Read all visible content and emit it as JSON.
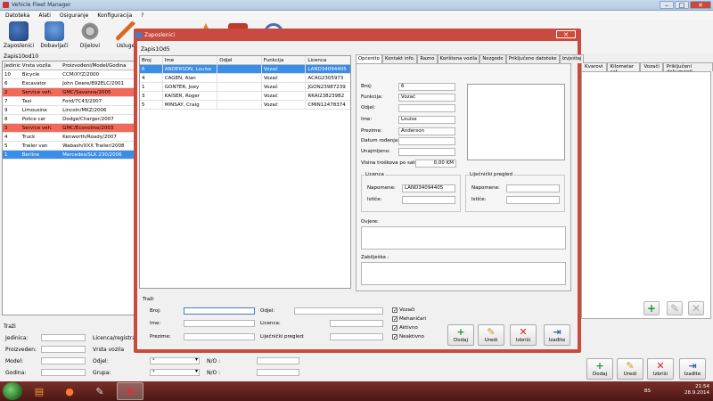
{
  "main": {
    "title": "Vehicle Fleet Manager",
    "menu": [
      "Datoteka",
      "Alati",
      "Osiguranje",
      "Konfiguracija",
      "?"
    ],
    "toolbar": [
      {
        "label": "Zaposlenici",
        "icon": "employees-icon"
      },
      {
        "label": "Dobavljači",
        "icon": "suppliers-icon"
      },
      {
        "label": "Dijelovi",
        "icon": "parts-gear-icon"
      },
      {
        "label": "Usluge",
        "icon": "services-tools-icon"
      }
    ],
    "record_count": "Zapis10od10",
    "vehicle_table": {
      "headers": [
        "Jedinic",
        "Vrsta vozila",
        "Proizvođeni/Model/Godina"
      ],
      "rows": [
        {
          "id": "10",
          "type": "Bicycle",
          "model": "CCM/XYZ/2000",
          "style": ""
        },
        {
          "id": "6",
          "type": "Excavator",
          "model": "John Deere/892ELC/2001",
          "style": ""
        },
        {
          "id": "2",
          "type": "Service veh.",
          "model": "GMC/Savanna/2005",
          "style": "red"
        },
        {
          "id": "7",
          "type": "Taxi",
          "model": "Ford/7C43/2007",
          "style": ""
        },
        {
          "id": "9",
          "type": "Limousine",
          "model": "Lincoln/MKZ/2006",
          "style": ""
        },
        {
          "id": "8",
          "type": "Police car",
          "model": "Dodge/Charger/2007",
          "style": ""
        },
        {
          "id": "3",
          "type": "Service veh.",
          "model": "GMC/Econoline/2003",
          "style": "red"
        },
        {
          "id": "4",
          "type": "Truck",
          "model": "Kenworth/Roady/2007",
          "style": ""
        },
        {
          "id": "5",
          "type": "Trailer van",
          "model": "Wabash/XXX Trailer/2008",
          "style": ""
        },
        {
          "id": "1",
          "type": "Berline",
          "model": "Mercedes/SLK 230/2006",
          "style": "blue"
        }
      ]
    },
    "right_tabs": [
      "Kvarovi",
      "Kilometar sat",
      "Vozači",
      "Priključeni dokumenti"
    ],
    "search": {
      "title": "Traži",
      "labels": {
        "jedinica": "Jedinica:",
        "proizveden": "Proizveden:",
        "model": "Model:",
        "godina": "Godina:",
        "licenca": "Licenca/registracija",
        "vrsta": "Vrsta vozila",
        "odjel": "Odjel:",
        "grupa": "Grupa:",
        "no1": "N/O :",
        "no2": "N/O :"
      },
      "odjel_value": "*",
      "grupa_value": "*"
    },
    "buttons": {
      "add": "Dodaj",
      "edit": "Uredi",
      "delete": "Izbriši",
      "exit": "Izađite"
    }
  },
  "dialog": {
    "title": "Zaposlenici",
    "record_count": "Zapis1Od5",
    "table": {
      "headers": [
        "Broj",
        "Ime",
        "Odjel",
        "Funkcija",
        "Licenca"
      ],
      "rows": [
        {
          "num": "6",
          "name": "ANDERSON, Louise",
          "dept": "",
          "func": "Vozač",
          "lic": "LAND34094405",
          "selected": true
        },
        {
          "num": "4",
          "name": "CAGEN, Alan",
          "dept": "",
          "func": "Vozač",
          "lic": "ACAG2305973",
          "selected": false
        },
        {
          "num": "1",
          "name": "GONTER, Joey",
          "dept": "",
          "func": "Vozač",
          "lic": "JGON23987239",
          "selected": false
        },
        {
          "num": "3",
          "name": "KAISER, Roger",
          "dept": "",
          "func": "Vozač",
          "lic": "RKAI23823982",
          "selected": false
        },
        {
          "num": "5",
          "name": "MINSAY, Craig",
          "dept": "",
          "func": "Vozač",
          "lic": "CMIN12478374",
          "selected": false
        }
      ]
    },
    "tabs": [
      "Općenito",
      "Kontakt info.",
      "Razno",
      "Korištena vozila",
      "Nezgode",
      "Priključene datoteke",
      "Izvještaj"
    ],
    "form": {
      "broj_label": "Broj:",
      "broj": "6",
      "funkcija_label": "Funkcija:",
      "funkcija": "Vozač",
      "odjel_label": "Odjel:",
      "odjel": "",
      "ime_label": "Ime:",
      "ime": "Louise",
      "prezime_label": "Prezime:",
      "prezime": "Anderson",
      "datum_label": "Datum rođenja:",
      "datum": "",
      "unajmljeno_label": "Unajmljeno:",
      "unajmljeno": "",
      "visina_label": "Visina troškova po satu:",
      "visina": "0,00 KM",
      "licenca_group": "Licenca",
      "napomene_label": "Napomene:",
      "napomene": "LAND34094405",
      "istice_label": "Ističe:",
      "istice": "",
      "ljec_group": "Liječnički pregled",
      "ljec_napomene_label": "Napomene:",
      "ljec_istice_label": "Ističe:",
      "ovjere_label": "Ovjere:",
      "zabiljeska_label": "Zabilješka :"
    },
    "search": {
      "title": "Traži",
      "broj": "Broj:",
      "ime": "Ime:",
      "prezime": "Prezime:",
      "odjel": "Odjel:",
      "licenca": "Licenca:",
      "ljec": "Liječnički pregled:",
      "checks": [
        {
          "label": "Vozači",
          "checked": true
        },
        {
          "label": "Mehaničari",
          "checked": true
        },
        {
          "label": "Aktivno",
          "checked": true
        },
        {
          "label": "Neaktivno",
          "checked": true
        }
      ]
    },
    "buttons": {
      "add": "Dodaj",
      "edit": "Uredi",
      "delete": "Izbriši",
      "exit": "Izađite"
    }
  },
  "taskbar": {
    "lang": "BS",
    "time": "21:54",
    "date": "28.9.2014"
  }
}
